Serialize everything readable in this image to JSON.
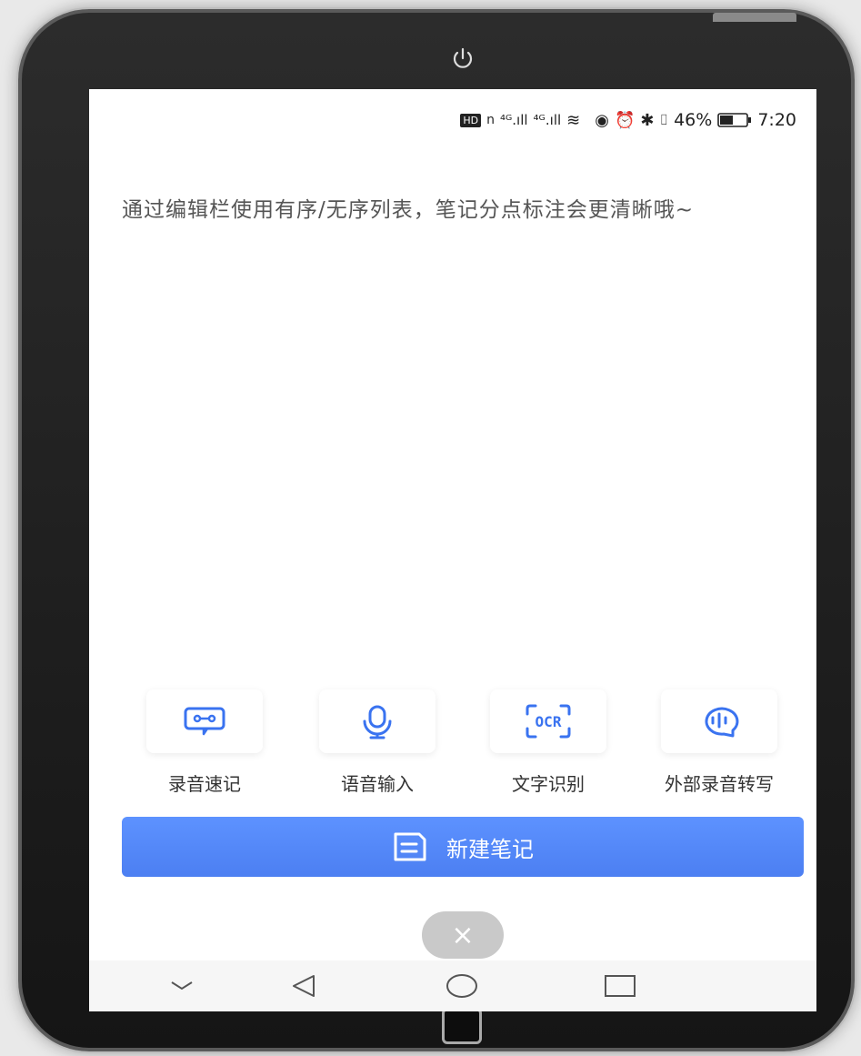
{
  "status_bar": {
    "icons": [
      "hd-icon",
      "nfc-icon",
      "signal-4g-icon",
      "signal-4g-icon",
      "wifi-icon",
      "eye-icon",
      "alarm-icon",
      "bluetooth-icon",
      "vibrate-icon"
    ],
    "battery_percent": "46%",
    "time": "7:20"
  },
  "hint": {
    "text": "通过编辑栏使用有序/无序列表，笔记分点标注会更清晰哦~"
  },
  "tools": [
    {
      "label": "录音速记",
      "icon": "recorder-icon"
    },
    {
      "label": "语音输入",
      "icon": "microphone-icon"
    },
    {
      "label": "文字识别",
      "icon": "ocr-icon"
    },
    {
      "label": "外部录音转写",
      "icon": "audio-transcribe-icon"
    }
  ],
  "new_note": {
    "label": "新建笔记",
    "icon": "note-icon"
  },
  "close_button": {
    "glyph": "×"
  },
  "nav_bar": {
    "items": [
      "collapse-icon",
      "back-icon",
      "home-icon",
      "recents-icon"
    ]
  },
  "colors": {
    "accent": "#4f83f4",
    "tool_icon": "#3a73f0"
  }
}
